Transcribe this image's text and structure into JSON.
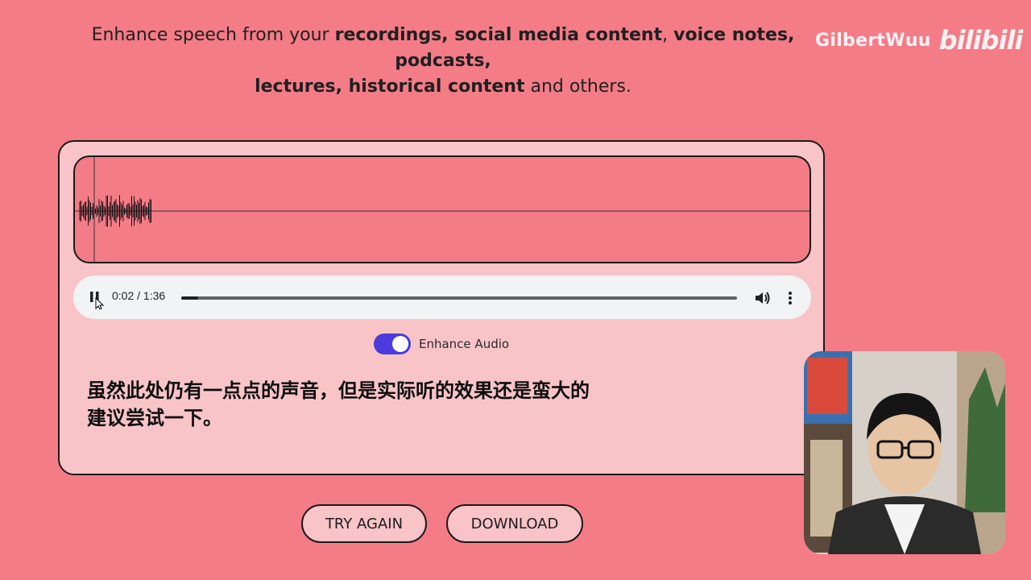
{
  "header": {
    "subtitle_parts": [
      {
        "text": "Enhance speech from your ",
        "bold": false
      },
      {
        "text": "recordings, social media content",
        "bold": true
      },
      {
        "text": ", ",
        "bold": false
      },
      {
        "text": "voice notes, podcasts,",
        "bold": true
      },
      {
        "text": " ",
        "bold": false
      },
      {
        "text": "lectures, historical content",
        "bold": true
      },
      {
        "text": " and others.",
        "bold": false
      }
    ]
  },
  "watermark": {
    "name": "GilbertWuu",
    "logo": "bilibili"
  },
  "player": {
    "state_icon": "pause-icon",
    "time": "0:02 / 1:36",
    "progress_fraction": 0.03
  },
  "toggle": {
    "label": "Enhance Audio",
    "on": true,
    "color": "#4b3bdc"
  },
  "transcript": {
    "line1": "虽然此处仍有一点点的声音，但是实际听的效果还是蛮大的",
    "line2": "建议尝试一下。"
  },
  "buttons": {
    "try_again": "TRY AGAIN",
    "download": "DOWNLOAD"
  },
  "colors": {
    "background": "#f47c87",
    "card": "#f8c4c8",
    "accent": "#4b3bdc"
  }
}
